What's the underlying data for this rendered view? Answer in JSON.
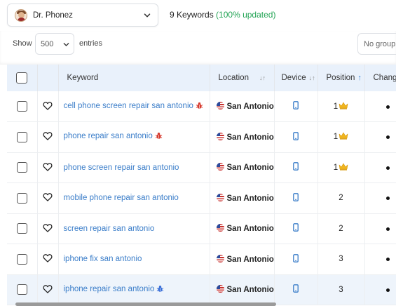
{
  "project": {
    "name": "Dr. Phonez"
  },
  "summary": {
    "count_text": "9 Keywords",
    "updated_text": "(100% updated)"
  },
  "toolbar": {
    "show_label": "Show",
    "entries_value": "500",
    "entries_label": "entries",
    "group_placeholder": "No group"
  },
  "table": {
    "headers": {
      "keyword": "Keyword",
      "location": "Location",
      "device": "Device",
      "position": "Position",
      "change": "Chang"
    },
    "rows": [
      {
        "keyword": "cell phone screen repair san antonio",
        "bug": "red",
        "location": "San Antonio",
        "device": "mobile",
        "position": "1",
        "crown": true,
        "change": "•"
      },
      {
        "keyword": "phone repair san antonio",
        "bug": "red",
        "location": "San Antonio",
        "device": "mobile",
        "position": "1",
        "crown": true,
        "change": "•"
      },
      {
        "keyword": "phone screen repair san antonio",
        "bug": "",
        "location": "San Antonio",
        "device": "mobile",
        "position": "1",
        "crown": true,
        "change": "•"
      },
      {
        "keyword": "mobile phone repair san antonio",
        "bug": "",
        "location": "San Antonio",
        "device": "mobile",
        "position": "2",
        "crown": false,
        "change": "•"
      },
      {
        "keyword": "screen repair san antonio",
        "bug": "",
        "location": "San Antonio",
        "device": "mobile",
        "position": "2",
        "crown": false,
        "change": "•"
      },
      {
        "keyword": "iphone fix san antonio",
        "bug": "",
        "location": "San Antonio",
        "device": "mobile",
        "position": "3",
        "crown": false,
        "change": "•"
      },
      {
        "keyword": "iphone repair san antonio",
        "bug": "blue",
        "location": "San Antonio",
        "device": "mobile",
        "position": "3",
        "crown": false,
        "change": "•"
      }
    ]
  },
  "colors": {
    "accent_blue": "#3a7dc9",
    "updated_green": "#23a455",
    "header_bg": "#e9f1fb",
    "bug_red": "#d63b2f",
    "bug_blue": "#3a6fd8",
    "crown_gold": "#f0b51e"
  },
  "icons": {
    "project_chevron": "chevron-down-icon",
    "favorite": "heart-outline-icon",
    "device": "mobile-phone-icon",
    "top_rank": "crown-icon",
    "sort": "sort-arrows-icon"
  }
}
